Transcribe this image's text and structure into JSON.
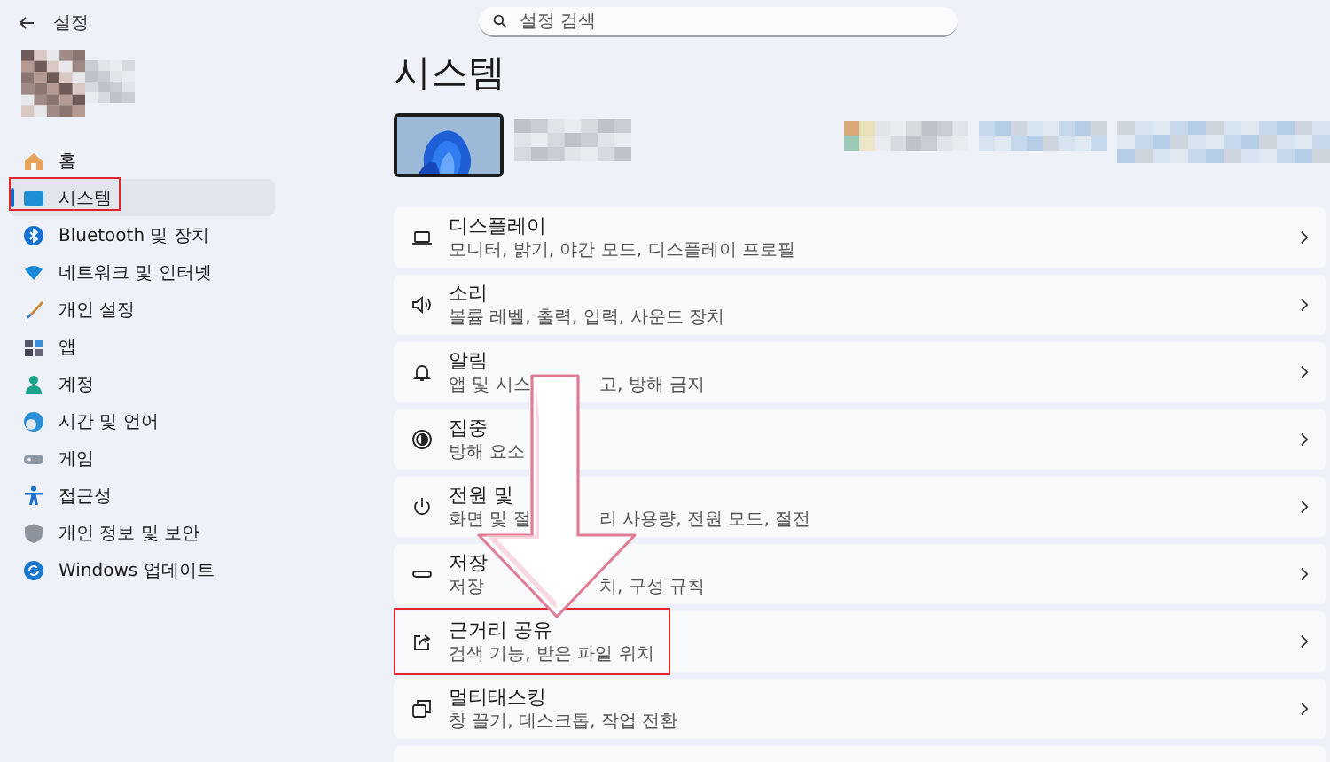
{
  "window": {
    "title": "설정"
  },
  "search": {
    "placeholder": "설정 검색"
  },
  "sidebar": {
    "items": [
      {
        "label": "홈",
        "selected": false,
        "annotated": false
      },
      {
        "label": "시스템",
        "selected": true,
        "annotated": true
      },
      {
        "label": "Bluetooth 및 장치",
        "selected": false,
        "annotated": false
      },
      {
        "label": "네트워크 및 인터넷",
        "selected": false,
        "annotated": false
      },
      {
        "label": "개인 설정",
        "selected": false,
        "annotated": false
      },
      {
        "label": "앱",
        "selected": false,
        "annotated": false
      },
      {
        "label": "계정",
        "selected": false,
        "annotated": false
      },
      {
        "label": "시간 및 언어",
        "selected": false,
        "annotated": false
      },
      {
        "label": "게임",
        "selected": false,
        "annotated": false
      },
      {
        "label": "접근성",
        "selected": false,
        "annotated": false
      },
      {
        "label": "개인 정보 및 보안",
        "selected": false,
        "annotated": false
      },
      {
        "label": "Windows 업데이트",
        "selected": false,
        "annotated": false
      }
    ]
  },
  "page": {
    "title": "시스템"
  },
  "cards": [
    {
      "title_parts": [
        "디스플레이"
      ],
      "subtitle_parts": [
        "모니터, 밝기, 야간 모드, 디스플레이 프로필"
      ],
      "annotated": false
    },
    {
      "title_parts": [
        "소리"
      ],
      "subtitle_parts": [
        "볼륨 레벨, 출력, 입력, 사운드 장치"
      ],
      "annotated": false
    },
    {
      "title_parts": [
        "알림"
      ],
      "subtitle_parts": [
        "앱 및 시스",
        "고, 방해 금지"
      ],
      "annotated": false
    },
    {
      "title_parts": [
        "집중"
      ],
      "subtitle_parts": [
        "방해 요소"
      ],
      "annotated": false
    },
    {
      "title_parts": [
        "전원 및"
      ],
      "subtitle_parts": [
        "화면 및 절",
        "리 사용량, 전원 모드, 절전"
      ],
      "annotated": false
    },
    {
      "title_parts": [
        "저장"
      ],
      "subtitle_parts": [
        "저장",
        "치, 구성 규칙"
      ],
      "annotated": false
    },
    {
      "title_parts": [
        "근거리 공유"
      ],
      "subtitle_parts": [
        "검색 기능, 받은 파일 위치"
      ],
      "annotated": true
    },
    {
      "title_parts": [
        "멀티태스킹"
      ],
      "subtitle_parts": [
        "창 끌기, 데스크톱, 작업 전환"
      ],
      "annotated": false
    }
  ]
}
